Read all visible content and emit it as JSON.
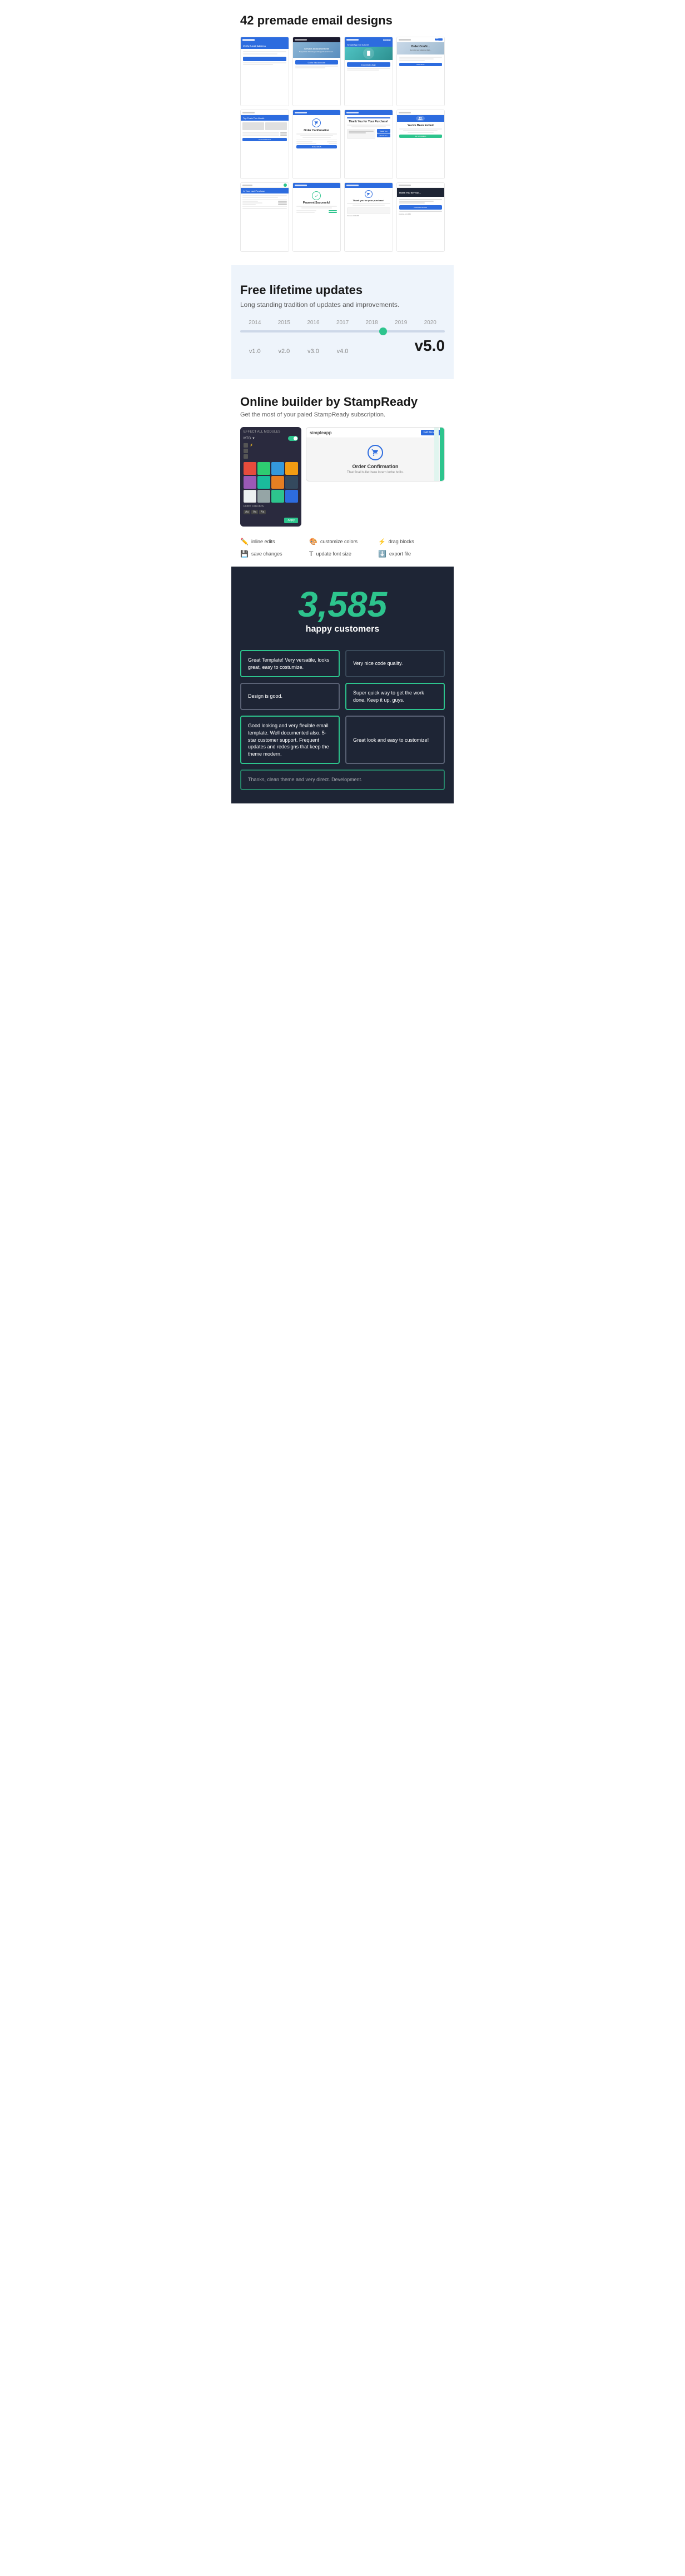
{
  "emailDesigns": {
    "sectionTitle": "42 premade email designs",
    "thumbs": [
      {
        "id": 1,
        "style": "blue-header",
        "type": "form"
      },
      {
        "id": 2,
        "style": "dark-header",
        "type": "announcement"
      },
      {
        "id": 3,
        "style": "blue-header",
        "type": "download"
      },
      {
        "id": 4,
        "style": "white-header",
        "type": "order-confirm"
      },
      {
        "id": 5,
        "style": "white-header",
        "type": "blog"
      },
      {
        "id": 6,
        "style": "blue-header",
        "type": "order-confirm-2"
      },
      {
        "id": 7,
        "style": "blue-header",
        "type": "thank-you"
      },
      {
        "id": 8,
        "style": "white-header",
        "type": "invited"
      },
      {
        "id": 9,
        "style": "white-header",
        "type": "purchase"
      },
      {
        "id": 10,
        "style": "blue-header",
        "type": "payment"
      },
      {
        "id": 11,
        "style": "blue-header",
        "type": "thank-you-2"
      },
      {
        "id": 12,
        "style": "white-header",
        "type": "thank-you-3"
      }
    ]
  },
  "updates": {
    "sectionTitle": "Free lifetime updates",
    "subtitle": "Long standing tradition of updates and improvements.",
    "years": [
      "2014",
      "2015",
      "2016",
      "2017",
      "2018",
      "2019",
      "2020"
    ],
    "versions": [
      "v1.0",
      "v2.0",
      "v3.0",
      "v4.0",
      "v5.0"
    ],
    "currentVersion": "v5.0",
    "dotPosition": "68%"
  },
  "builder": {
    "sectionTitle": "Online builder by StampReady",
    "subtitle": "Get the most of your paied StampReady subscription.",
    "panelHeader": "EFFECT ALL MODULES",
    "toggleLabel": "MTG ▼",
    "colorSwatches": [
      "#e74c3c",
      "#2ecc71",
      "#3498db",
      "#f39c12",
      "#9b59b6",
      "#1abc9c",
      "#e67e22",
      "#34495e",
      "#ecf0f1",
      "#95a5a6",
      "#2dc48d",
      "#2d6cdf"
    ],
    "fontLabel": "FONT COLORS",
    "fontOptions": [
      "Aa",
      "Aa",
      "Aa"
    ],
    "previewTitle": "Order Confirmation",
    "previewSubtitle": "That final bullet here lorem lorbe bollo.",
    "previewLogoText": "simpleapp",
    "previewBtnLabel": "Get the App",
    "features": [
      {
        "icon": "✏️",
        "label": "inline edits"
      },
      {
        "icon": "🎨",
        "label": "customize colors"
      },
      {
        "icon": "⚡",
        "label": "drag blocks"
      },
      {
        "icon": "💾",
        "label": "save changes"
      },
      {
        "icon": "T",
        "label": "update font size"
      },
      {
        "icon": "⬇️",
        "label": "export file"
      }
    ]
  },
  "customers": {
    "count": "3,585",
    "label": "happy customers",
    "testimonials": [
      {
        "text": "Great Template! Very versatile, looks great, easy to costumize.",
        "style": "green-border"
      },
      {
        "text": "Very nice code quality.",
        "style": "no-border"
      },
      {
        "text": "Design is good.",
        "style": "white-border"
      },
      {
        "text": "Super quick way to get the work done. Keep it up, guys.",
        "style": "green-border"
      },
      {
        "text": "Good looking and very flexible email template. Well documented also. 5-star customer support. Frequent updates and redesigns that keep the theme modern.",
        "style": "green-border"
      },
      {
        "text": "Great look and easy to customize!",
        "style": "white-border"
      },
      {
        "text": "Thanks, clean theme and very direct. Development.",
        "style": "green-border-dim"
      }
    ]
  }
}
